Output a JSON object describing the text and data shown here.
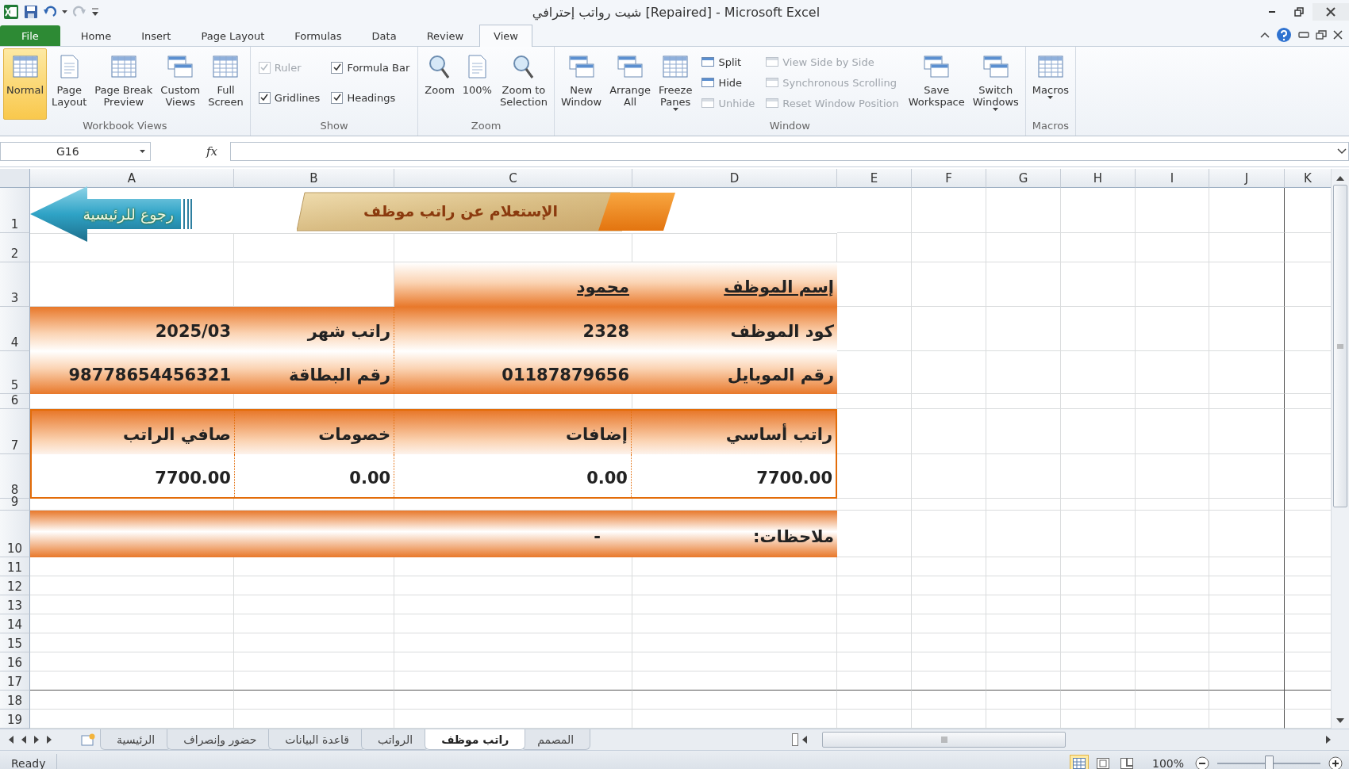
{
  "window": {
    "title": "شيت رواتب إحترافي [Repaired]  -  Microsoft Excel"
  },
  "ribbon_tabs": [
    {
      "label": "File",
      "kind": "file",
      "selected": false
    },
    {
      "label": "Home",
      "kind": "tab",
      "selected": false
    },
    {
      "label": "Insert",
      "kind": "tab",
      "selected": false
    },
    {
      "label": "Page Layout",
      "kind": "tab",
      "selected": false
    },
    {
      "label": "Formulas",
      "kind": "tab",
      "selected": false
    },
    {
      "label": "Data",
      "kind": "tab",
      "selected": false
    },
    {
      "label": "Review",
      "kind": "tab",
      "selected": false
    },
    {
      "label": "View",
      "kind": "tab",
      "selected": true
    }
  ],
  "ribbon_groups": [
    {
      "label": "Workbook Views",
      "items": [
        {
          "label": "Normal",
          "kind": "large",
          "selected": true
        },
        {
          "label": "Page\nLayout",
          "kind": "large",
          "selected": false
        },
        {
          "label": "Page Break\nPreview",
          "kind": "large",
          "selected": false
        },
        {
          "label": "Custom\nViews",
          "kind": "large",
          "selected": false
        },
        {
          "label": "Full\nScreen",
          "kind": "large",
          "selected": false
        }
      ]
    },
    {
      "label": "Show",
      "items": [
        {
          "label": "Ruler",
          "kind": "check",
          "checked": true,
          "disabled": true
        },
        {
          "label": "Gridlines",
          "kind": "check",
          "checked": true,
          "disabled": false
        },
        {
          "label": "Formula Bar",
          "kind": "check",
          "checked": true,
          "disabled": false
        },
        {
          "label": "Headings",
          "kind": "check",
          "checked": true,
          "disabled": false
        }
      ]
    },
    {
      "label": "Zoom",
      "items": [
        {
          "label": "Zoom",
          "kind": "large",
          "selected": false
        },
        {
          "label": "100%",
          "kind": "large",
          "selected": false
        },
        {
          "label": "Zoom to\nSelection",
          "kind": "large",
          "selected": false
        }
      ]
    },
    {
      "label": "Window",
      "items": [
        {
          "label": "New\nWindow",
          "kind": "large",
          "selected": false
        },
        {
          "label": "Arrange\nAll",
          "kind": "large",
          "selected": false
        },
        {
          "label": "Freeze\nPanes",
          "kind": "large",
          "selected": false,
          "dropdown": true
        },
        {
          "label": "Split",
          "kind": "small",
          "disabled": false
        },
        {
          "label": "Hide",
          "kind": "small",
          "disabled": false
        },
        {
          "label": "Unhide",
          "kind": "small",
          "disabled": true
        },
        {
          "label": "View Side by Side",
          "kind": "small",
          "disabled": true
        },
        {
          "label": "Synchronous Scrolling",
          "kind": "small",
          "disabled": true
        },
        {
          "label": "Reset Window Position",
          "kind": "small",
          "disabled": true
        },
        {
          "label": "Save\nWorkspace",
          "kind": "large",
          "selected": false
        },
        {
          "label": "Switch\nWindows",
          "kind": "large",
          "selected": false,
          "dropdown": true
        }
      ]
    },
    {
      "label": "Macros",
      "items": [
        {
          "label": "Macros",
          "kind": "large",
          "selected": false,
          "dropdown": true
        }
      ]
    }
  ],
  "formula_bar": {
    "name_box": "G16",
    "fx": "fx"
  },
  "sheet": {
    "columns": [
      "A",
      "B",
      "C",
      "D",
      "E",
      "F",
      "G",
      "H",
      "I",
      "J",
      "K"
    ],
    "rows": [
      "1",
      "2",
      "3",
      "4",
      "5",
      "6",
      "7",
      "8",
      "9",
      "10",
      "11",
      "12",
      "13",
      "14",
      "15",
      "16",
      "17",
      "18",
      "19"
    ],
    "back_button": {
      "label": "رجوع للرئيسية"
    },
    "banner": {
      "title": "الإستعلام عن راتب موظف"
    },
    "employee_name": {
      "label": "إسم الموظف",
      "value": "محمود"
    },
    "employee_rows": [
      [
        "2025/03",
        "راتب شهر",
        "2328",
        "كود الموظف"
      ],
      [
        "98778654456321",
        "رقم البطاقة",
        "01187879656",
        "رقم الموبايل"
      ]
    ],
    "salary_table": {
      "columns": [
        "راتب أساسي",
        "إضافات",
        "خصومات",
        "صافي الراتب"
      ],
      "values": [
        "7700.00",
        "0.00",
        "0.00",
        "7700.00"
      ]
    },
    "notes": {
      "label": "ملاحظات:",
      "value": "-"
    }
  },
  "sheet_tabs": [
    {
      "label": "المصمم",
      "selected": false
    },
    {
      "label": "راتب موظف",
      "selected": true
    },
    {
      "label": "الرواتب",
      "selected": false
    },
    {
      "label": "قاعدة البيانات",
      "selected": false
    },
    {
      "label": "حضور وإنصراف",
      "selected": false
    },
    {
      "label": "الرئيسية",
      "selected": false
    }
  ],
  "status_bar": {
    "status": "Ready",
    "view_buttons": [
      {
        "selected": true
      },
      {
        "selected": false
      },
      {
        "selected": false
      }
    ],
    "zoom": "100%",
    "zoom_slider": {
      "level": 0.5
    }
  }
}
